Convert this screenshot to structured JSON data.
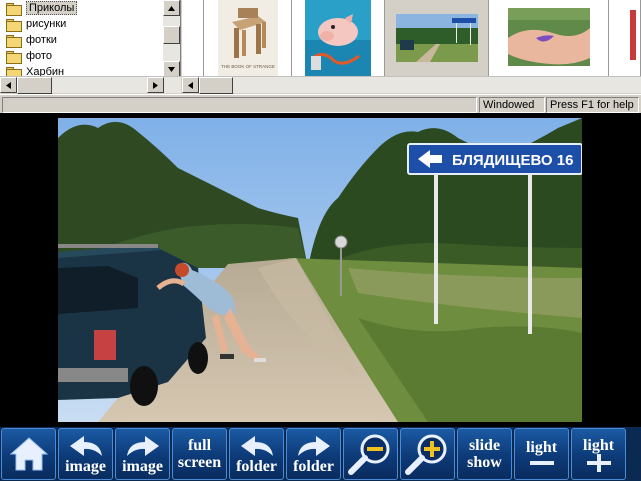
{
  "tree": {
    "items": [
      {
        "label": "Приколы",
        "selected": true
      },
      {
        "label": "рисунки",
        "selected": false
      },
      {
        "label": "фотки",
        "selected": false
      },
      {
        "label": "фото",
        "selected": false
      },
      {
        "label": "Харбин",
        "selected": false
      }
    ]
  },
  "thumbnails": [
    {
      "name": "thumb-chair-poster",
      "caption": "THE BOOK OF STRANGE"
    },
    {
      "name": "thumb-pig",
      "caption": ""
    },
    {
      "name": "thumb-road-sign",
      "caption": ""
    },
    {
      "name": "thumb-bikini",
      "caption": ""
    }
  ],
  "status": {
    "mode": "Windowed",
    "help": "Press F1 for help"
  },
  "photo": {
    "sign_text": "БЛЯДИЩЕВО 16"
  },
  "toolbar": {
    "home": "",
    "prev_image_label": "image",
    "next_image_label": "image",
    "full_screen_line1": "full",
    "full_screen_line2": "screen",
    "prev_folder_label": "folder",
    "next_folder_label": "folder",
    "zoom_out": "",
    "zoom_in": "",
    "slide_show_line1": "slide",
    "slide_show_line2": "show",
    "light_minus_label": "light",
    "light_plus_label": "light"
  },
  "colors": {
    "toolbar_bg": "#0a2a52",
    "button_accent": "#1b5aa3",
    "sign_blue": "#1d4fa8"
  }
}
